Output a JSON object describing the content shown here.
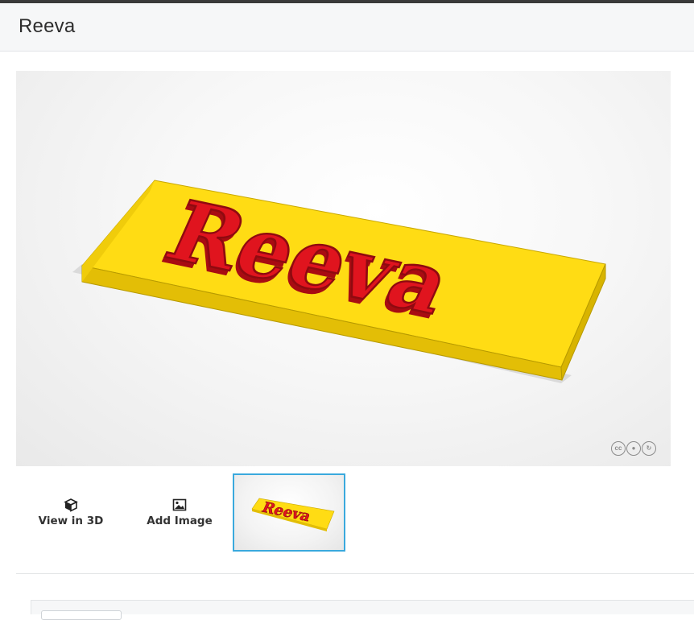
{
  "header": {
    "title": "Reeva"
  },
  "model": {
    "name_text": "Reeva",
    "plate_color": "#ffd90f",
    "letter_color": "#e0141e"
  },
  "license_icons": [
    "cc-icon",
    "attribution-icon",
    "share-alike-icon"
  ],
  "actions": {
    "view_3d_label": "View in 3D",
    "add_image_label": "Add Image"
  },
  "thumbnail": {
    "text": "Reeva",
    "selected": true
  }
}
